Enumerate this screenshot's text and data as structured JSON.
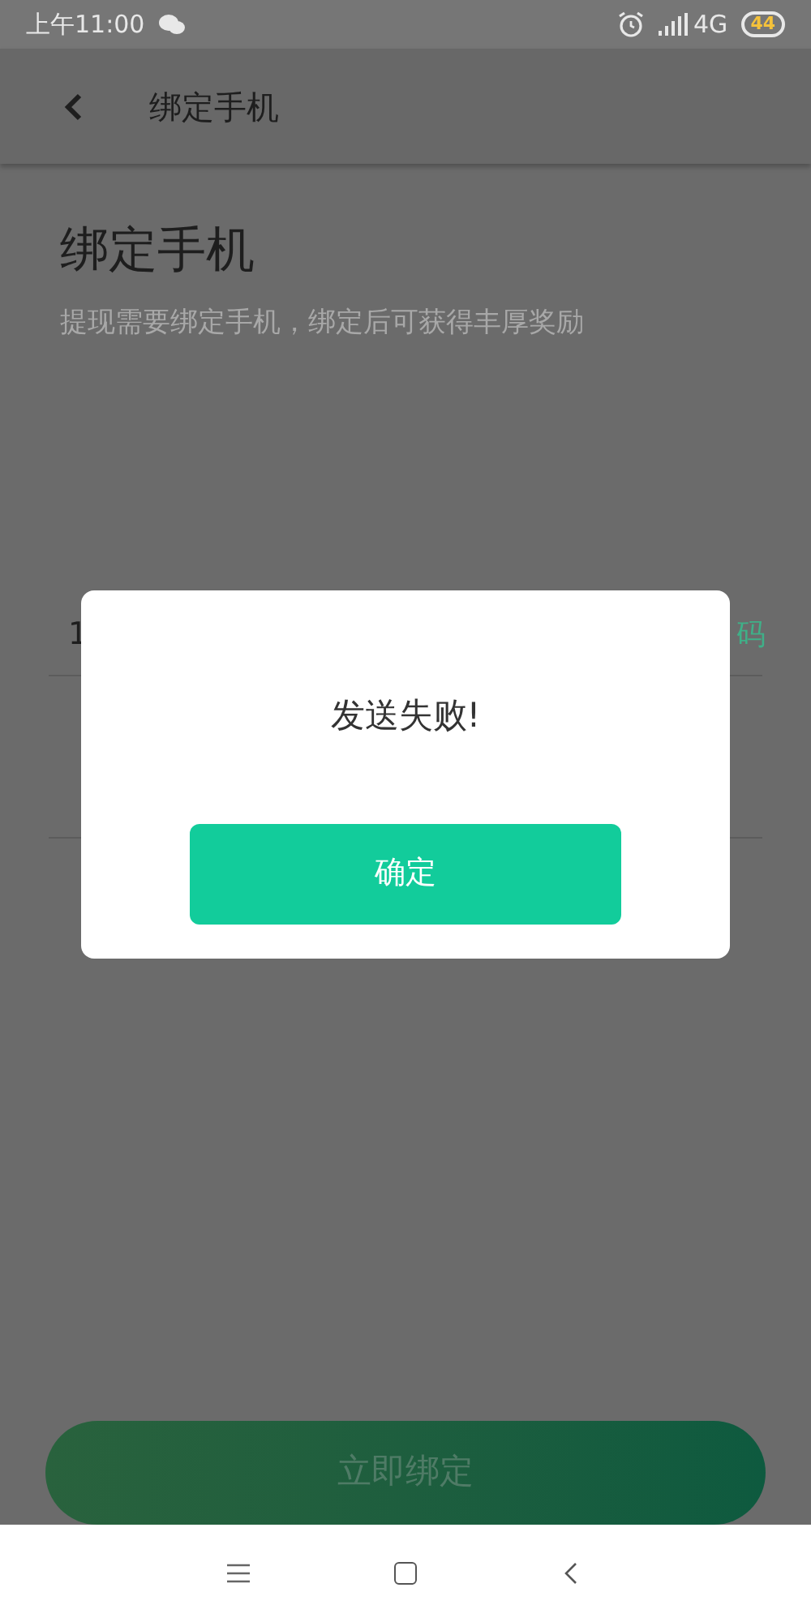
{
  "status_bar": {
    "time": "上午11:00",
    "network": "4G",
    "battery": "44"
  },
  "header": {
    "title": "绑定手机"
  },
  "page": {
    "heading": "绑定手机",
    "subtitle": "提现需要绑定手机，绑定后可获得丰厚奖励",
    "phone_field": {
      "value": "1"
    },
    "code_button": "码",
    "submit_button": "立即绑定"
  },
  "dialog": {
    "message": "发送失败!",
    "button": "确定"
  }
}
